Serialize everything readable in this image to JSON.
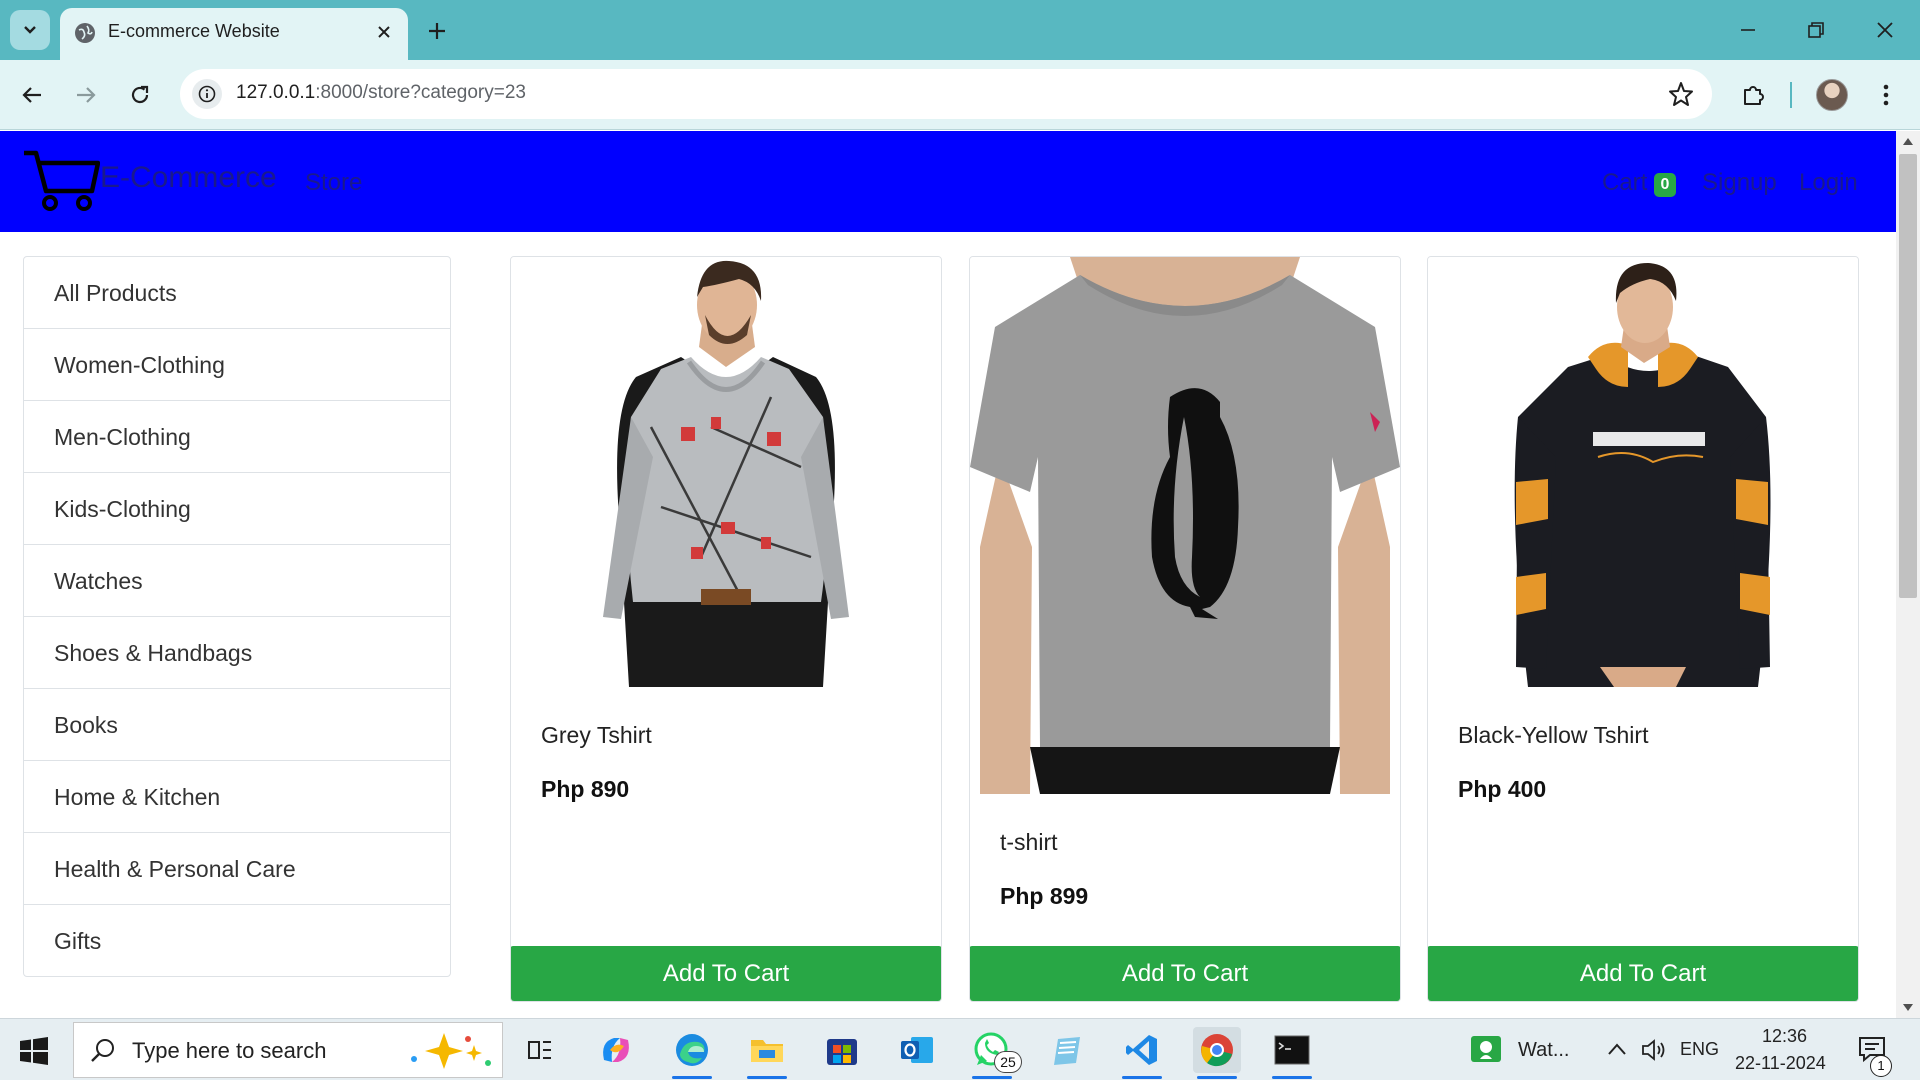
{
  "browser": {
    "tab_title": "E-commerce Website",
    "url_host": "127.0.0.1",
    "url_rest": ":8000/store?category=23"
  },
  "navbar": {
    "brand": "E-Commerce",
    "store": "Store",
    "cart": "Cart",
    "cart_count": "0",
    "signup": "Signup",
    "login": "Login"
  },
  "categories": [
    "All Products",
    "Women-Clothing",
    "Men-Clothing",
    "Kids-Clothing",
    "Watches",
    "Shoes & Handbags",
    "Books",
    "Home & Kitchen",
    "Health & Personal Care",
    "Gifts"
  ],
  "products": [
    {
      "name": "Grey Tshirt",
      "price": "Php 890",
      "button": "Add To Cart"
    },
    {
      "name": "t-shirt",
      "price": "Php 899",
      "button": "Add To Cart"
    },
    {
      "name": "Black-Yellow Tshirt",
      "price": "Php 400",
      "button": "Add To Cart"
    }
  ],
  "taskbar": {
    "search_placeholder": "Type here to search",
    "whatsapp_badge": "25",
    "running_app": "Wat...",
    "language": "ENG",
    "time": "12:36",
    "date": "22-11-2024",
    "notifications": "1"
  },
  "colors": {
    "navbar": "#0000ff",
    "button": "#28a745",
    "tabstrip": "#58b8c1"
  }
}
